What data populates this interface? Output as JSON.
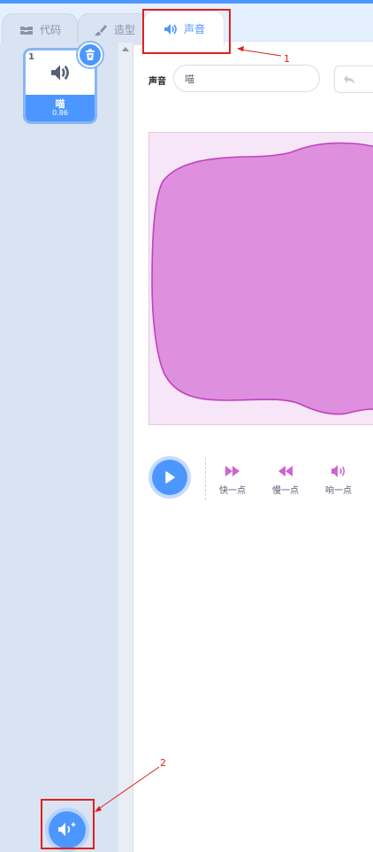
{
  "tabs": [
    {
      "label": "代码",
      "icon": "code-blocks-icon"
    },
    {
      "label": "造型",
      "icon": "brush-icon"
    },
    {
      "label": "声音",
      "icon": "speaker-icon"
    }
  ],
  "sound_list": {
    "items": [
      {
        "index": "1",
        "name": "喵",
        "duration": "0.86",
        "icon": "speaker-icon"
      }
    ]
  },
  "editor": {
    "name_label": "声音",
    "name_value": "喵"
  },
  "effects": [
    {
      "label": "快一点",
      "icon": "fast-forward-icon"
    },
    {
      "label": "慢一点",
      "icon": "rewind-icon"
    },
    {
      "label": "响一点",
      "icon": "volume-up-icon"
    }
  ],
  "annotations": [
    "1",
    "2"
  ],
  "colors": {
    "accent": "#4c97ff",
    "wave_fill": "#de8fde",
    "wave_stroke": "#c041c0",
    "wave_bg": "#f7e6f7",
    "effect_icon": "#cf63cf",
    "annotation": "#e0201c"
  }
}
